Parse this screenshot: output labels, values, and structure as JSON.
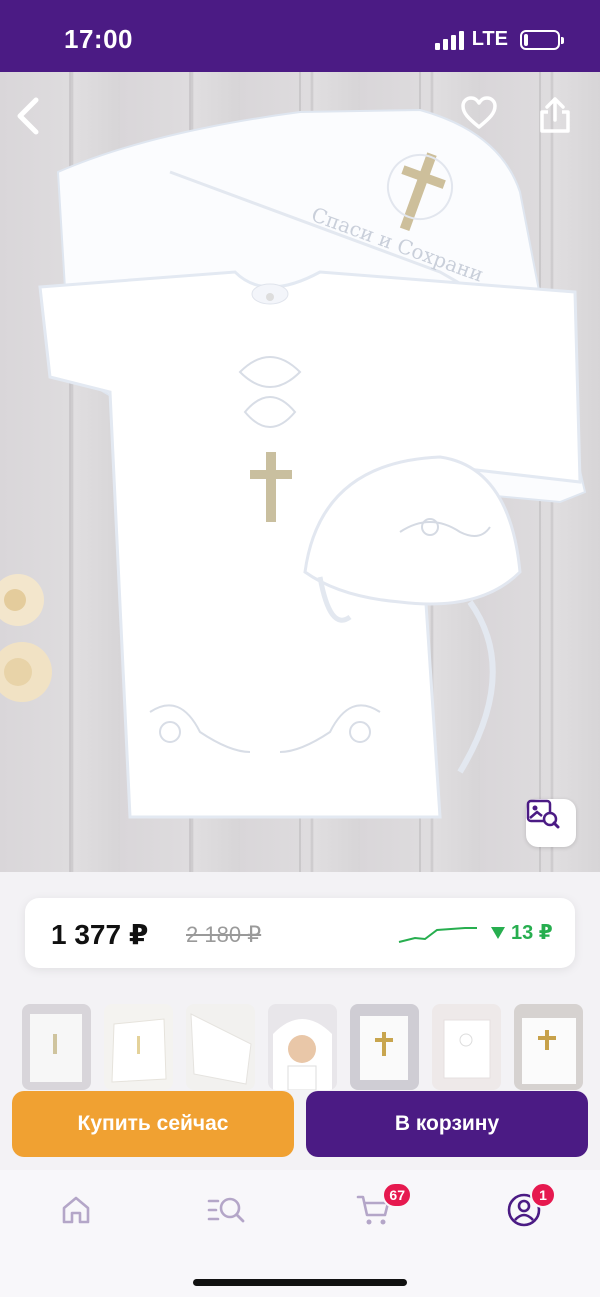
{
  "status_bar": {
    "time": "17:00",
    "network": "LTE"
  },
  "product_image": {
    "embroidery_text": "Спаси и Сохрани",
    "actions": {
      "back_icon": "chevron-left-icon",
      "favorite_icon": "heart-icon",
      "share_icon": "share-icon",
      "visual_search_icon": "image-search-icon"
    }
  },
  "price": {
    "current": "1 377 ₽",
    "old": "2 180 ₽",
    "drop": "13 ₽",
    "trend_color": "#27ae4f"
  },
  "thumbnails": [
    {
      "label": "thumbnail-1"
    },
    {
      "label": "thumbnail-2"
    },
    {
      "label": "thumbnail-3"
    },
    {
      "label": "thumbnail-4"
    },
    {
      "label": "thumbnail-5"
    },
    {
      "label": "thumbnail-6"
    },
    {
      "label": "thumbnail-7"
    }
  ],
  "actions": {
    "buy_now": "Купить сейчас",
    "add_to_cart": "В корзину"
  },
  "bottom_nav": {
    "cart_badge": "67",
    "profile_badge": "1"
  },
  "colors": {
    "brand": "#4b1b84",
    "accent": "#f0a132",
    "badge": "#e6194f"
  }
}
